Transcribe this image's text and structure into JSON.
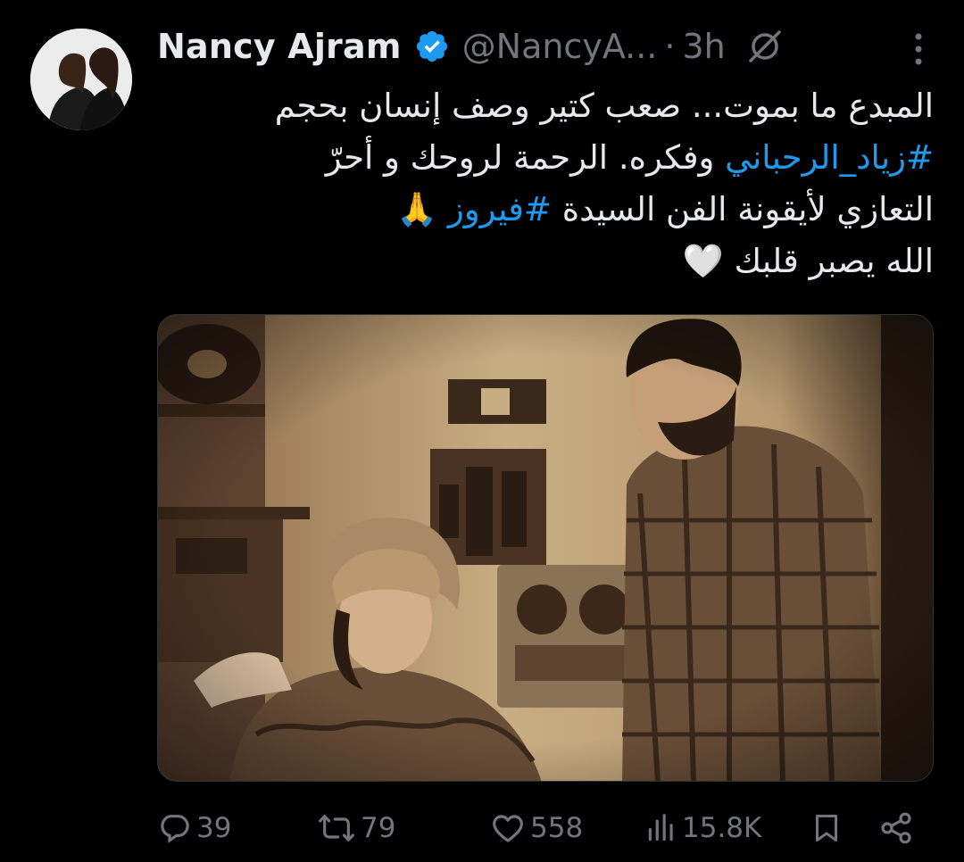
{
  "tweet": {
    "author_name": "Nancy Ajram",
    "handle": "@NancyA...",
    "separator": "·",
    "time": "3h",
    "text_lines": [
      {
        "parts": [
          {
            "t": "المبدع ما بموت... صعب كتير وصف إنسان بحجم",
            "tag": false
          }
        ]
      },
      {
        "parts": [
          {
            "t": "#زياد_الرحباني",
            "tag": true
          },
          {
            "t": " وفكره. الرحمة لروحك و أحرّ",
            "tag": false
          }
        ]
      },
      {
        "parts": [
          {
            "t": "التعازي لأيقونة الفن السيدة ",
            "tag": false
          },
          {
            "t": "#فيروز",
            "tag": true
          },
          {
            "t": " 🙏",
            "tag": false
          }
        ]
      },
      {
        "parts": [
          {
            "t": "الله يصبر قلبك 🤍",
            "tag": false
          }
        ]
      }
    ]
  },
  "actions": {
    "replies": "39",
    "reposts": "79",
    "likes": "558",
    "views": "15.8K"
  },
  "colors": {
    "background": "#000000",
    "text": "#e7e9ea",
    "muted": "#71767b",
    "accent": "#1d9bf0"
  },
  "icons": [
    "verified-badge-icon",
    "grok-icon",
    "more-icon",
    "reply-icon",
    "repost-icon",
    "like-icon",
    "views-icon",
    "bookmark-icon",
    "share-icon"
  ]
}
